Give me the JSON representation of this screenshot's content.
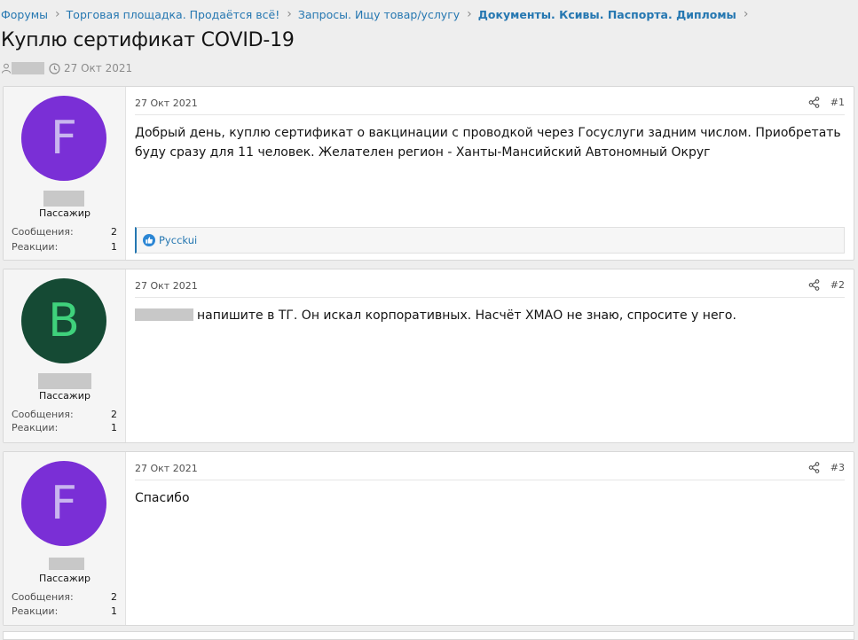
{
  "breadcrumb": [
    {
      "label": "Форумы"
    },
    {
      "label": "Торговая площадка. Продаётся всё!"
    },
    {
      "label": "Запросы. Ищу товар/услугу"
    },
    {
      "label": "Документы. Ксивы. Паспорта. Дипломы"
    }
  ],
  "thread": {
    "title": "Куплю сертификат COVID-19",
    "date": "27 Окт 2021"
  },
  "posts": [
    {
      "avatar_letter": "F",
      "avatar_color": "#7a2fd6",
      "avatar_text_color": "#c9b5ef",
      "user_title": "Пассажир",
      "messages_label": "Сообщения:",
      "messages_value": "2",
      "reactions_label": "Реакции:",
      "reactions_value": "1",
      "date": "27 Окт 2021",
      "number": "#1",
      "body": "Добрый день, куплю сертификат о вакцинации с проводкой через Госуслуги задним числом. Приобретать буду сразу для 11 человек. Желателен регион - Ханты-Мансийский Автономный Округ",
      "reaction_user": "Pycckui"
    },
    {
      "avatar_letter": "B",
      "avatar_color": "#154a34",
      "avatar_text_color": "#3fd27c",
      "user_title": "Пассажир",
      "messages_label": "Сообщения:",
      "messages_value": "2",
      "reactions_label": "Реакции:",
      "reactions_value": "1",
      "date": "27 Окт 2021",
      "number": "#2",
      "body": "напишите в ТГ. Он искал корпоративных. Насчёт ХМАО не знаю, спросите у него."
    },
    {
      "avatar_letter": "F",
      "avatar_color": "#7a2fd6",
      "avatar_text_color": "#c9b5ef",
      "user_title": "Пассажир",
      "messages_label": "Сообщения:",
      "messages_value": "2",
      "reactions_label": "Реакции:",
      "reactions_value": "1",
      "date": "27 Окт 2021",
      "number": "#3",
      "body": "Спасибо"
    }
  ],
  "icons": {
    "user": "user-icon",
    "clock": "clock-icon",
    "share": "share-icon",
    "like": "like-icon"
  },
  "colors": {
    "link": "#2577b1",
    "page_bg": "#eeeeee"
  }
}
